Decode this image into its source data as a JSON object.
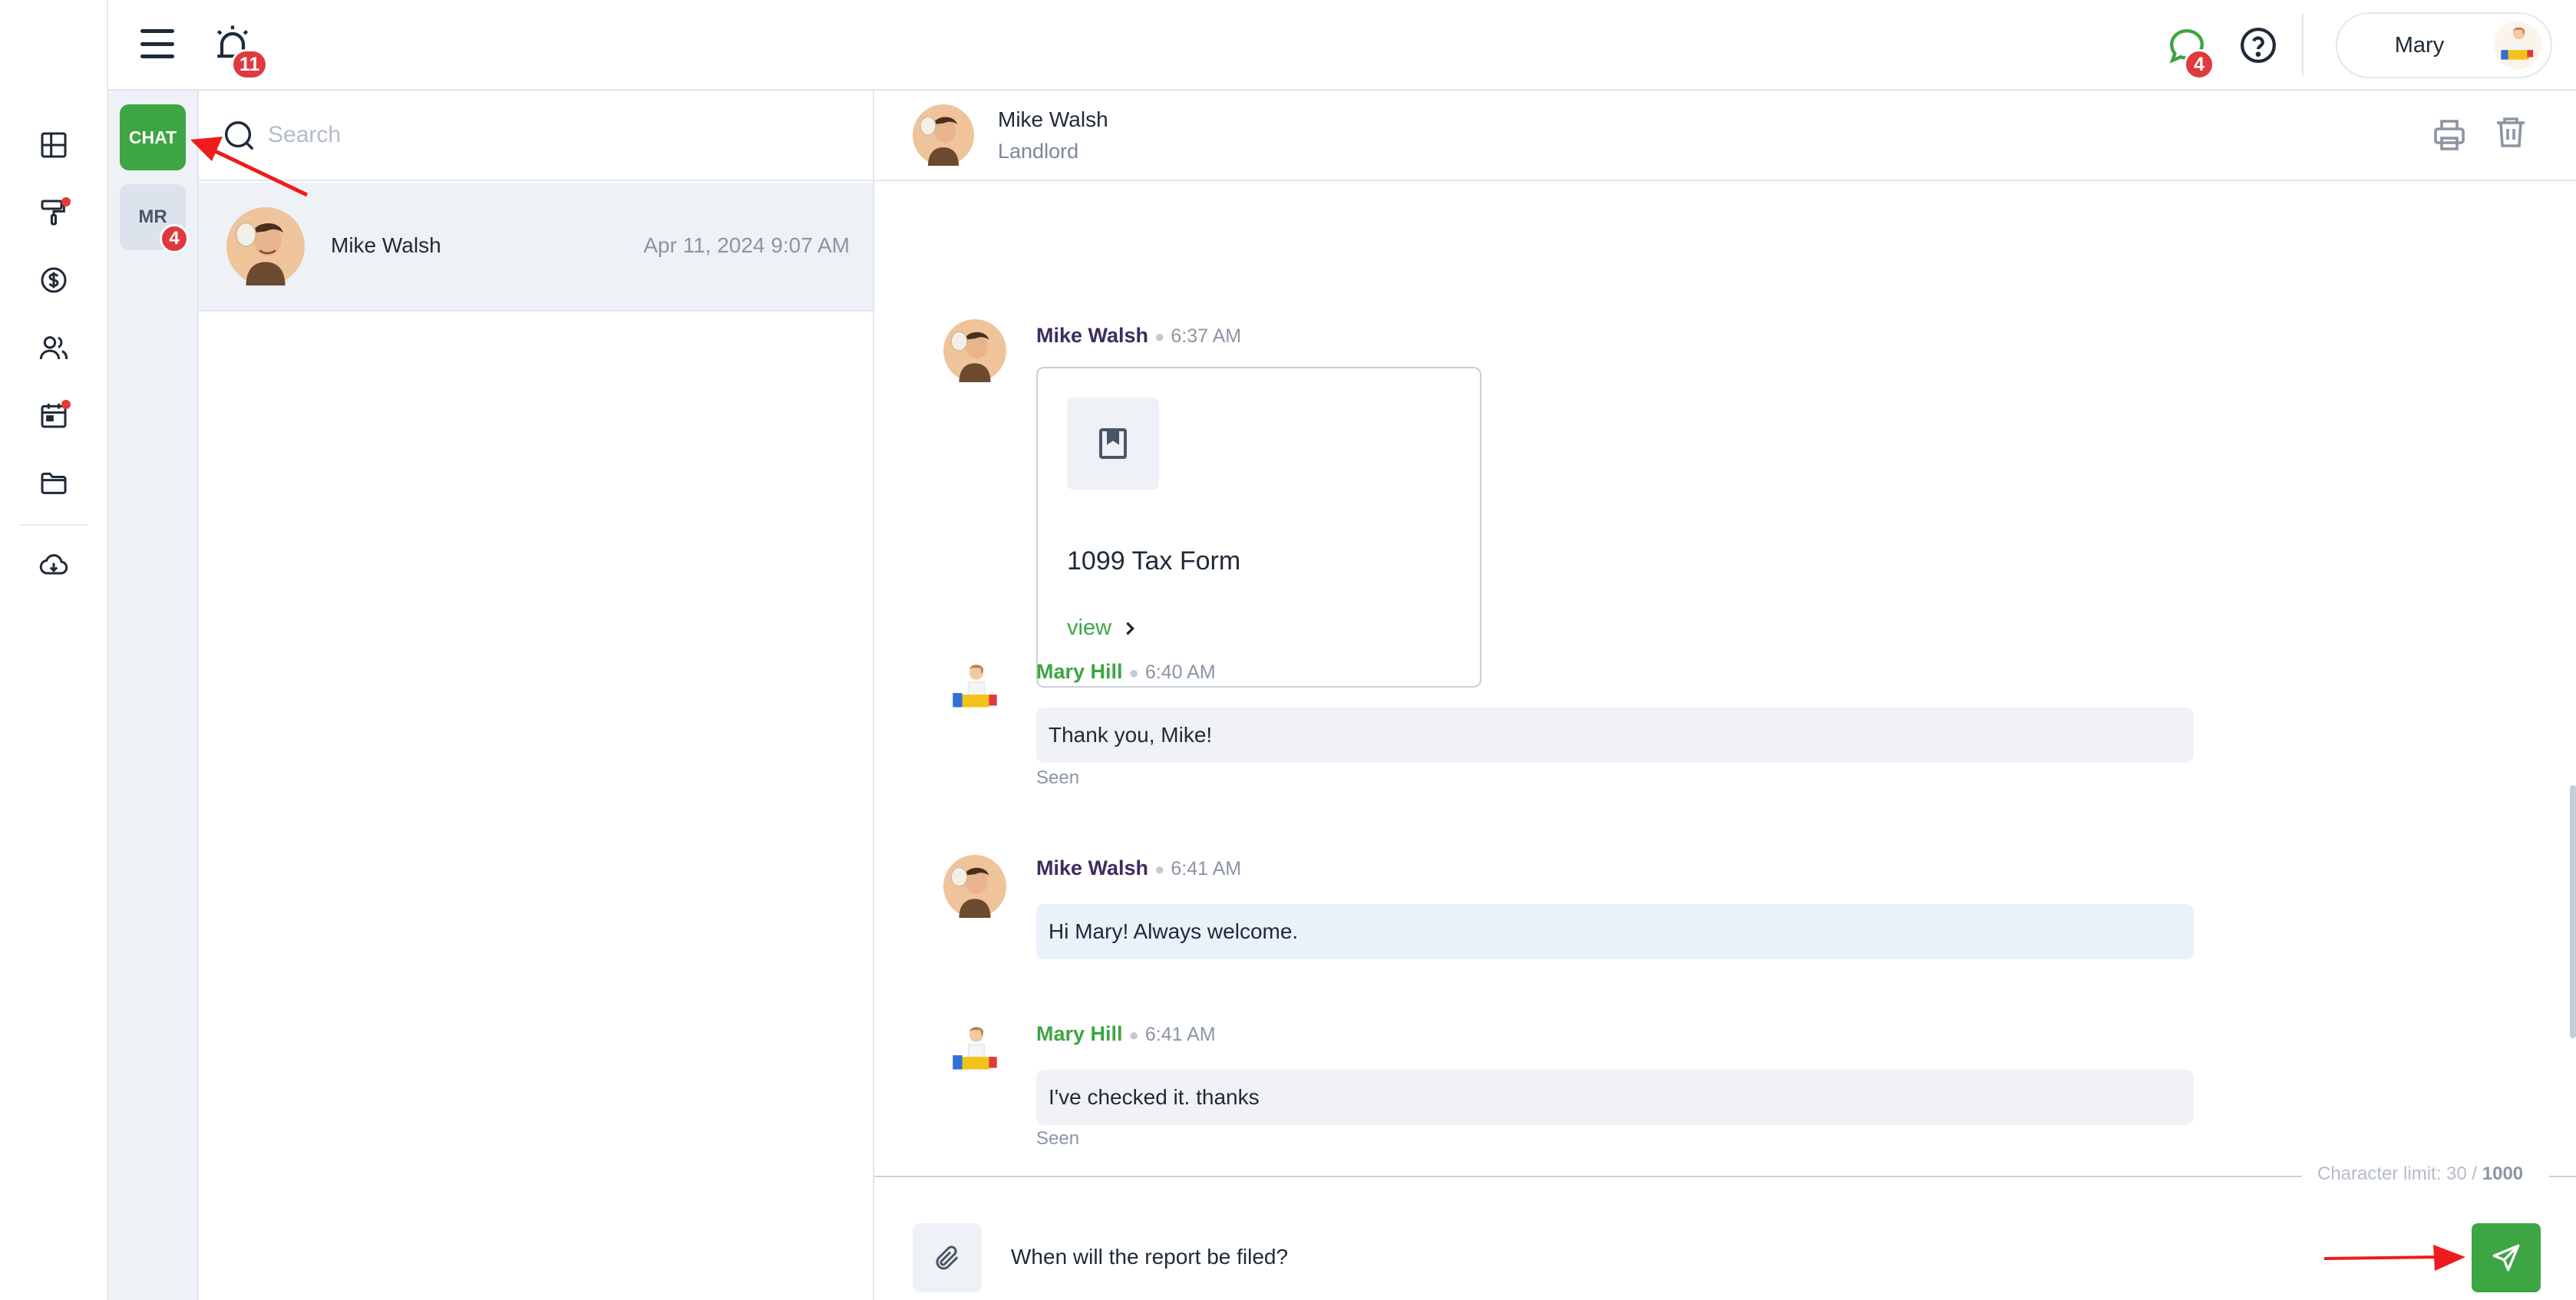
{
  "colors": {
    "brand_green": "#3da542",
    "badge_red": "#e0393e",
    "rail_dot_red": "#e53935",
    "annotation_red": "#ee1c1c"
  },
  "rail": {
    "items": [
      {
        "icon": "dashboard-icon",
        "dot": false
      },
      {
        "icon": "paint-roller-icon",
        "dot": true
      },
      {
        "icon": "dollar-icon",
        "dot": false
      },
      {
        "icon": "users-icon",
        "dot": false
      },
      {
        "icon": "calendar-icon",
        "dot": true
      },
      {
        "icon": "folder-icon",
        "dot": false
      },
      {
        "icon": "cloud-download-icon",
        "dot": false
      }
    ]
  },
  "header": {
    "alarm_count": "11",
    "chat_count": "4",
    "user_name": "Mary"
  },
  "types": {
    "chat_label": "CHAT",
    "mr_label": "MR",
    "mr_count": "4"
  },
  "search": {
    "placeholder": "Search"
  },
  "conversations": [
    {
      "name": "Mike Walsh",
      "date": "Apr 11, 2024 9:07 AM"
    }
  ],
  "chat": {
    "contact_name": "Mike Walsh",
    "contact_role": "Landlord",
    "messages": [
      {
        "author": "Mike Walsh",
        "time": "6:37 AM",
        "type": "document",
        "doc_title": "1099 Tax Form",
        "doc_action": "view"
      },
      {
        "author": "Mary Hill",
        "time": "6:40 AM",
        "text": "Thank you, Mike!",
        "status": "Seen"
      },
      {
        "author": "Mike Walsh",
        "time": "6:41 AM",
        "text": "Hi Mary! Always welcome."
      },
      {
        "author": "Mary Hill",
        "time": "6:41 AM",
        "text": "I've checked it. thanks",
        "status": "Seen"
      }
    ]
  },
  "composer": {
    "char_limit_label": "Character limit: 30 /",
    "char_limit_max": "1000",
    "value": "When will the report be filed?"
  }
}
